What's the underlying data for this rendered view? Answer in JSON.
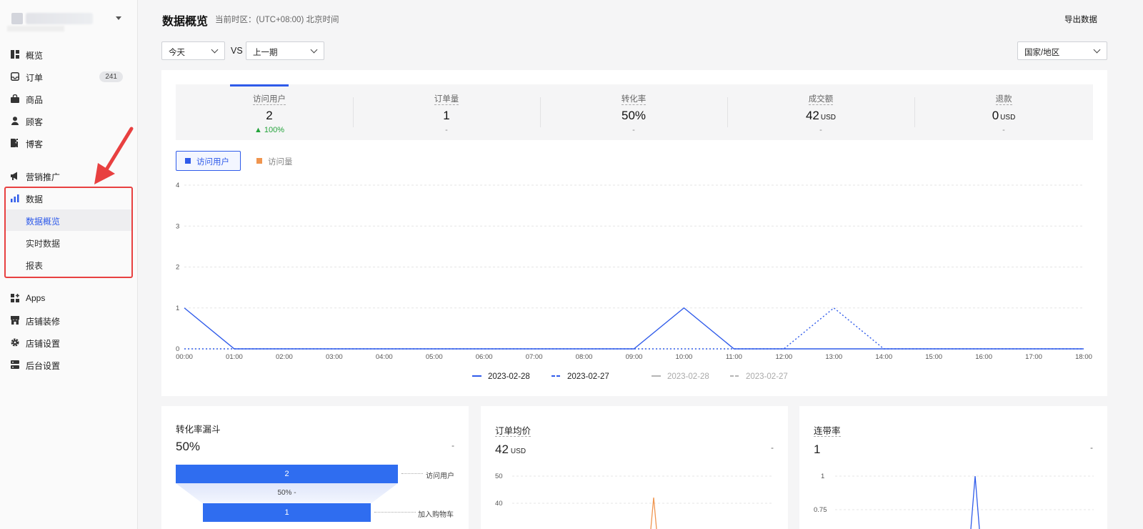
{
  "sidebar": {
    "nav": [
      {
        "label": "概览",
        "icon": "dashboard-icon"
      },
      {
        "label": "订单",
        "icon": "inbox-icon",
        "badge": "241"
      },
      {
        "label": "商品",
        "icon": "bag-icon"
      },
      {
        "label": "顾客",
        "icon": "user-icon"
      },
      {
        "label": "博客",
        "icon": "blog-icon"
      },
      {
        "label": "营销推广",
        "icon": "megaphone-icon"
      },
      {
        "label": "数据",
        "icon": "bar-chart-icon"
      },
      {
        "label": "数据概览"
      },
      {
        "label": "实时数据"
      },
      {
        "label": "报表"
      },
      {
        "label": "Apps",
        "icon": "apps-icon"
      },
      {
        "label": "店铺装修",
        "icon": "store-icon"
      },
      {
        "label": "店铺设置",
        "icon": "gear-icon"
      },
      {
        "label": "后台设置",
        "icon": "server-icon"
      }
    ]
  },
  "header": {
    "title": "数据概览",
    "timezone": "当前时区：(UTC+08:00) 北京时间",
    "export": "导出数据"
  },
  "filters": {
    "period": "今天",
    "vs": "VS",
    "compare": "上一期",
    "region": "国家/地区"
  },
  "kpis": [
    {
      "name": "访问用户",
      "value": "2",
      "unit": "",
      "change": "100%"
    },
    {
      "name": "订单量",
      "value": "1",
      "unit": "",
      "change": "-"
    },
    {
      "name": "转化率",
      "value": "50%",
      "unit": "",
      "change": "-"
    },
    {
      "name": "成交额",
      "value": "42",
      "unit": "USD",
      "change": "-"
    },
    {
      "name": "退款",
      "value": "0",
      "unit": "USD",
      "change": "-"
    }
  ],
  "metric_tabs": [
    {
      "label": "访问用户",
      "color": "#2f5bea"
    },
    {
      "label": "访问量",
      "color": "#f0954f"
    }
  ],
  "chart_data": {
    "type": "line",
    "x": [
      "00:00",
      "01:00",
      "02:00",
      "03:00",
      "04:00",
      "05:00",
      "06:00",
      "07:00",
      "08:00",
      "09:00",
      "10:00",
      "11:00",
      "12:00",
      "13:00",
      "14:00",
      "15:00",
      "16:00",
      "17:00",
      "18:00"
    ],
    "yticks": [
      0,
      1,
      2,
      3,
      4
    ],
    "ylim": [
      0,
      4
    ],
    "grid": true,
    "legend_position": "bottom",
    "series": [
      {
        "name": "2023-02-28",
        "style": "solid",
        "color": "#2f5bea",
        "active": true,
        "values": [
          1,
          0,
          0,
          0,
          0,
          0,
          0,
          0,
          0,
          0,
          1,
          0,
          0,
          0,
          0,
          0,
          0,
          0,
          0
        ]
      },
      {
        "name": "2023-02-27",
        "style": "dashed",
        "color": "#2f5bea",
        "active": true,
        "values": [
          0,
          0,
          0,
          0,
          0,
          0,
          0,
          0,
          0,
          0,
          0,
          0,
          0,
          1,
          0,
          0,
          0,
          0,
          0
        ]
      },
      {
        "name": "2023-02-28",
        "style": "solid",
        "color": "#b5b5b5",
        "active": false,
        "values": []
      },
      {
        "name": "2023-02-27",
        "style": "dashed",
        "color": "#b5b5b5",
        "active": false,
        "values": []
      }
    ]
  },
  "bottom": {
    "funnel": {
      "title": "转化率漏斗",
      "value": "50%",
      "change": "-",
      "steps": [
        {
          "label": "访问用户",
          "value": "2"
        },
        {
          "label": "加入购物车",
          "value": "1"
        }
      ],
      "rate": "50% -"
    },
    "aov": {
      "title": "订单均价",
      "value": "42",
      "unit": "USD",
      "change": "-",
      "yticks": [
        "50",
        "40"
      ]
    },
    "attach": {
      "title": "连带率",
      "value": "1",
      "change": "-",
      "yticks": [
        "1",
        "0.75"
      ]
    }
  }
}
